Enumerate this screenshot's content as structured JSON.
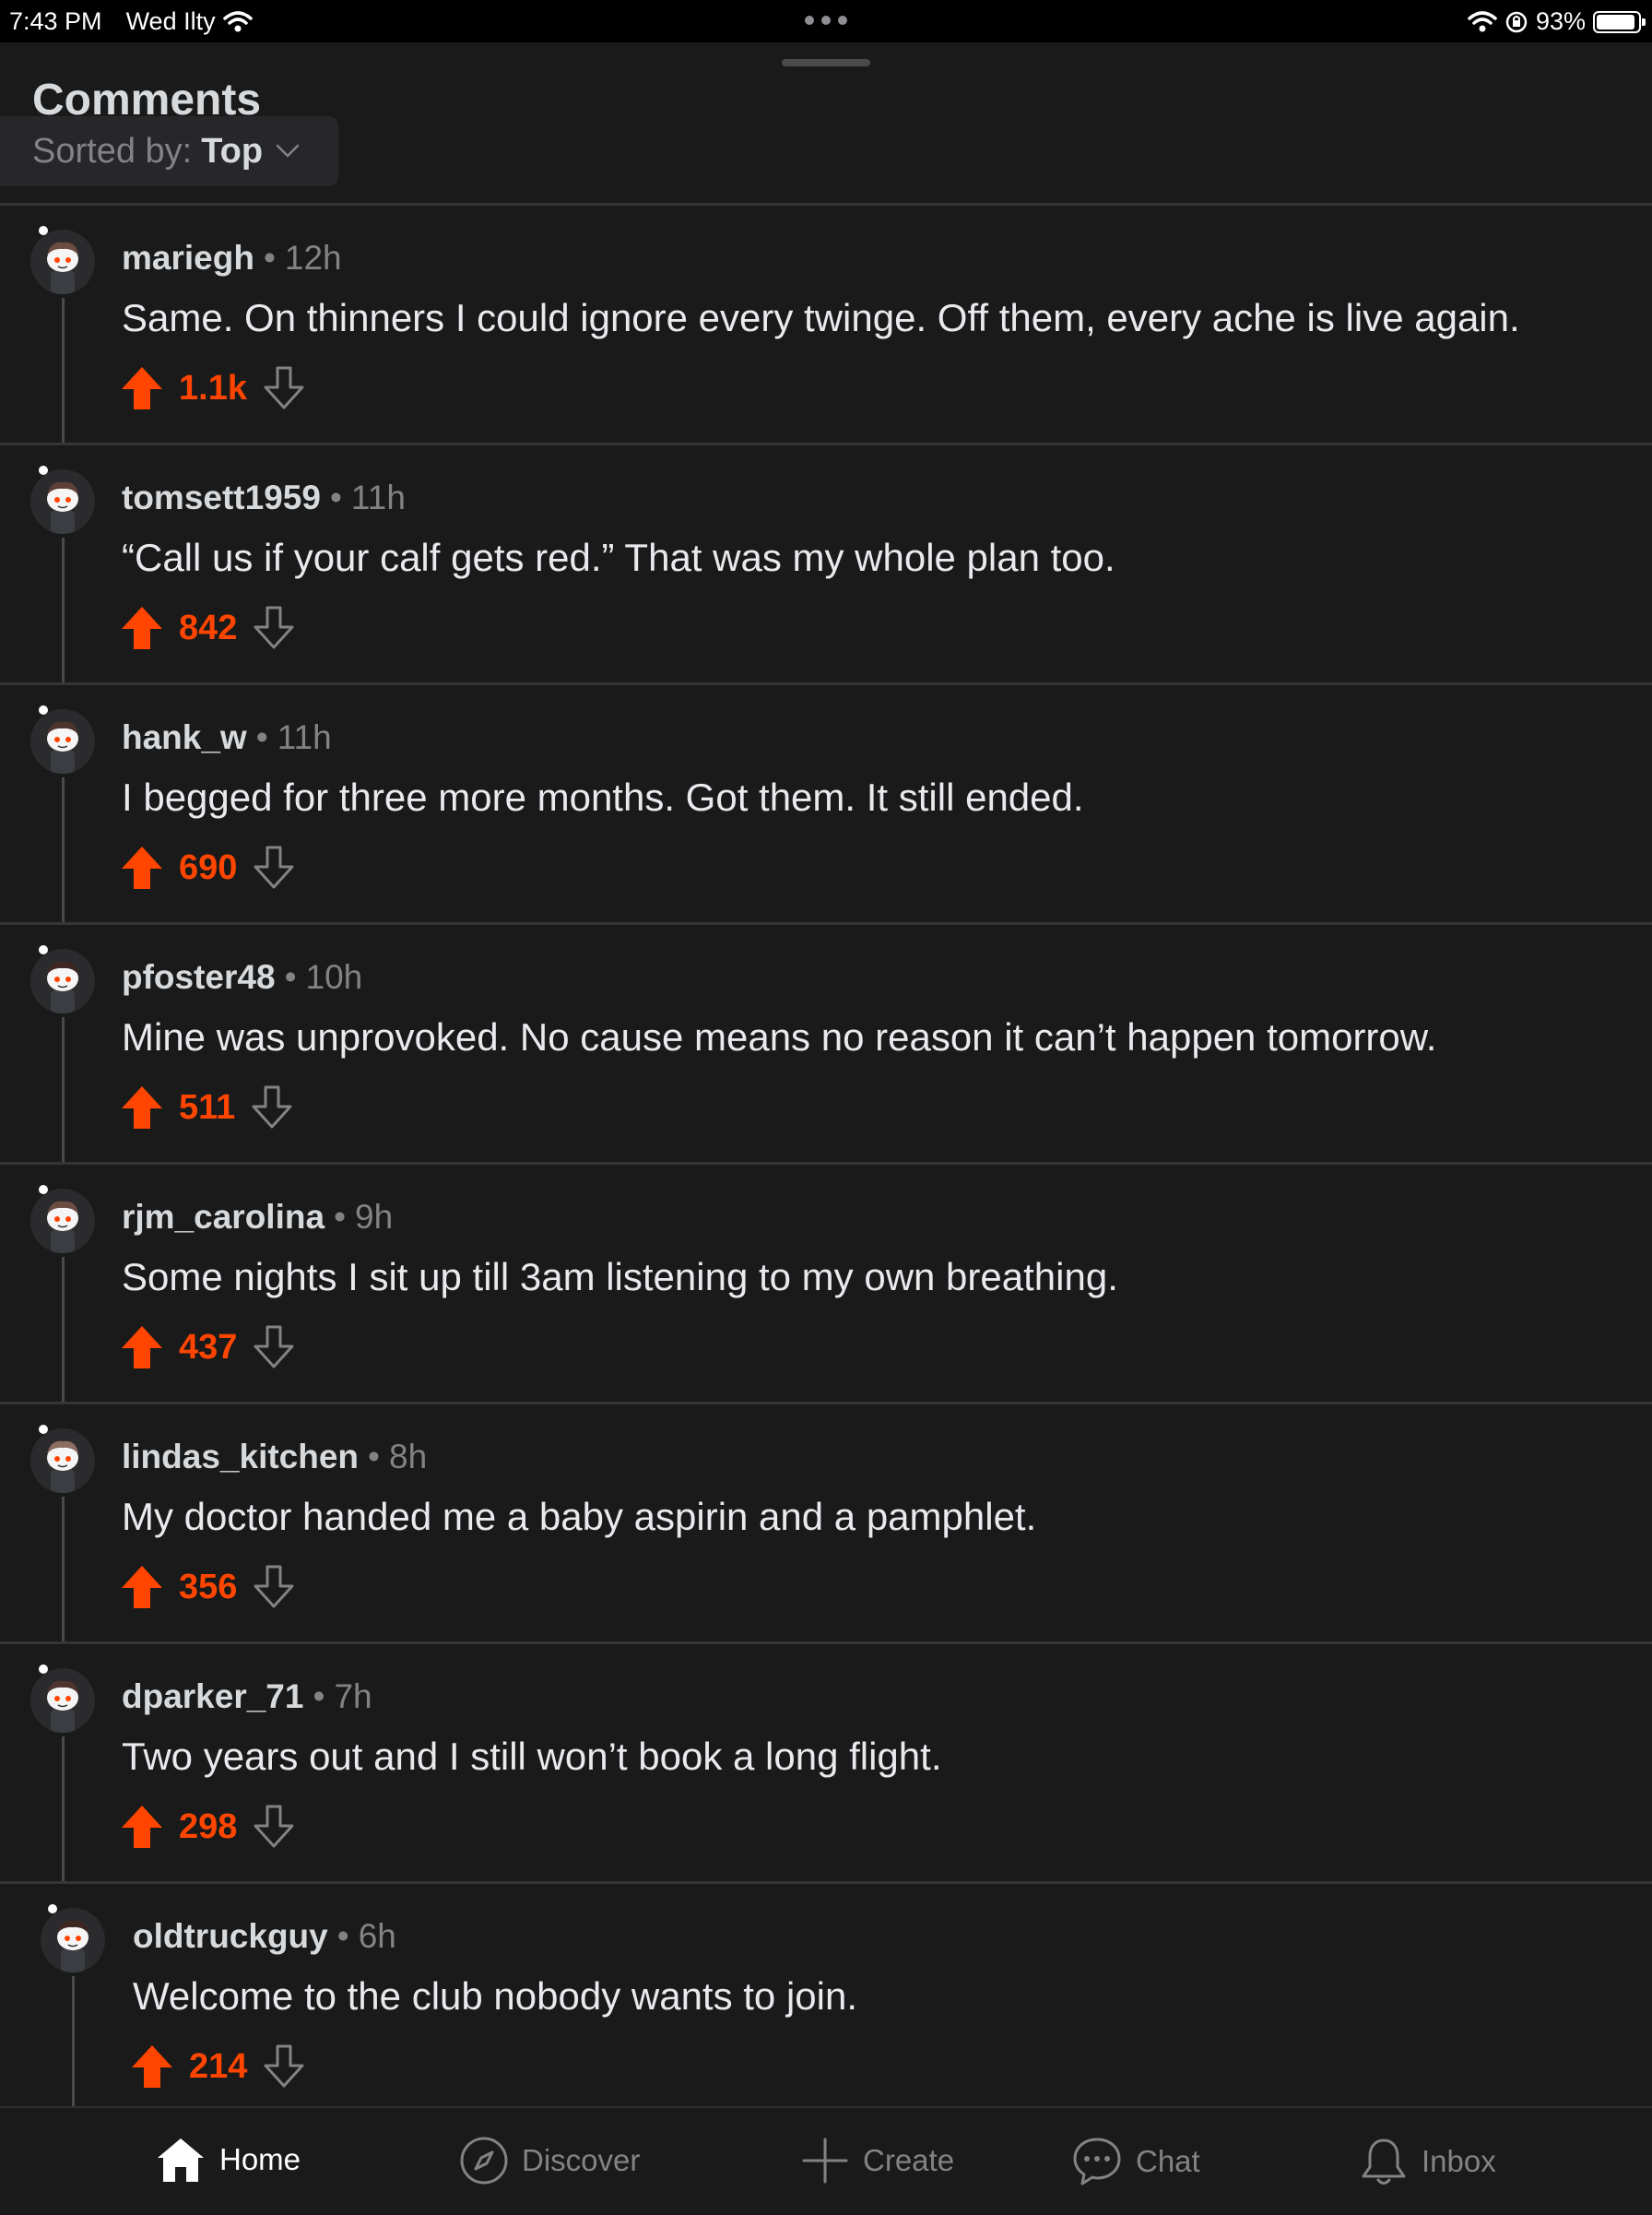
{
  "status": {
    "time": "7:43 PM",
    "date": "Wed Ilty",
    "battery": "93%",
    "battery_level": 0.93
  },
  "header": {
    "title": "Comments",
    "sort_prefix": "Sorted by:",
    "sort_value": "Top"
  },
  "comments": [
    {
      "author": "mariegh",
      "age": "12h",
      "text": "Same. On thinners I could ignore every twinge. Off them, every ache is live again.",
      "score": "1.1k"
    },
    {
      "author": "tomsett1959",
      "age": "11h",
      "text": "“Call us if your calf gets red.” That was my whole plan too.",
      "score": "842"
    },
    {
      "author": "hank_w",
      "age": "11h",
      "text": "I begged for three more months. Got them. It still ended.",
      "score": "690"
    },
    {
      "author": "pfoster48",
      "age": "10h",
      "text": "Mine was unprovoked. No cause means no reason it can’t happen tomorrow.",
      "score": "511"
    },
    {
      "author": "rjm_carolina",
      "age": "9h",
      "text": "Some nights I sit up till 3am listening to my own breathing.",
      "score": "437"
    },
    {
      "author": "lindas_kitchen",
      "age": "8h",
      "text": "My doctor handed me a baby aspirin and a pamphlet.",
      "score": "356"
    },
    {
      "author": "dparker_71",
      "age": "7h",
      "text": "Two years out and I still won’t book a long flight.",
      "score": "298"
    },
    {
      "author": "oldtruckguy",
      "age": "6h",
      "text": "Welcome to the club nobody wants to join.",
      "score": "214"
    }
  ],
  "tabs": {
    "home": "Home",
    "discover": "Discover",
    "create": "Create",
    "chat": "Chat",
    "inbox": "Inbox"
  },
  "colors": {
    "accent": "#ff4500",
    "background": "#1a1a1b",
    "text": "#d7dadc",
    "muted": "#818384"
  }
}
